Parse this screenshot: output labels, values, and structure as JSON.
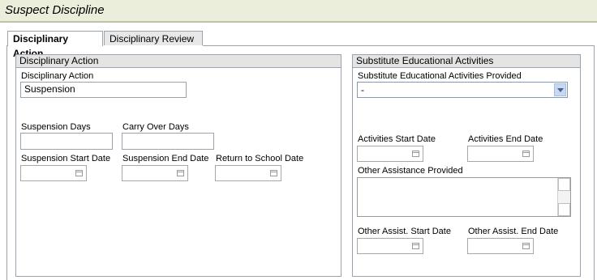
{
  "page": {
    "title": "Suspect Discipline"
  },
  "tabs": [
    {
      "label": "Disciplinary Action",
      "active": true
    },
    {
      "label": "Disciplinary Review",
      "active": false
    }
  ],
  "disciplinary_panel": {
    "title": "Disciplinary Action",
    "action_label": "Disciplinary Action",
    "action_value": "Suspension",
    "suspension_days_label": "Suspension Days",
    "suspension_days_value": "",
    "carry_over_days_label": "Carry Over Days",
    "carry_over_days_value": "",
    "start_date_label": "Suspension Start Date",
    "end_date_label": "Suspension End Date",
    "return_date_label": "Return to School Date"
  },
  "substitute_panel": {
    "title": "Substitute Educational Activities",
    "provided_label": "Substitute Educational Activities Provided",
    "provided_value": "-",
    "activities_start_label": "Activities Start Date",
    "activities_end_label": "Activities End Date",
    "other_assistance_label": "Other Assistance Provided",
    "other_assistance_value": "",
    "other_start_label": "Other Assist. Start Date",
    "other_end_label": "Other Assist. End Date"
  },
  "icons": [
    "calendar-icon",
    "chevron-down-icon",
    "scroll-up-icon",
    "scroll-down-icon"
  ],
  "colors": {
    "header_bg": "#ECEEDC",
    "panel_title_bg": "#E4E4E4",
    "border": "#9AA3B0"
  }
}
